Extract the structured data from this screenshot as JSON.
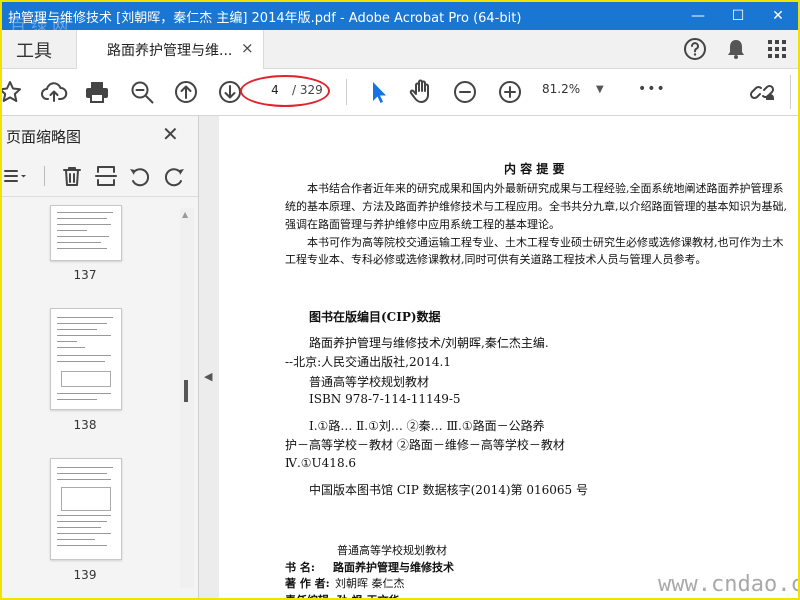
{
  "window": {
    "title": "护管理与维修技术 [刘朝晖，秦仁杰 主编] 2014年版.pdf - Adobe Acrobat Pro (64-bit)",
    "watermark": "百 绿 网",
    "controls": [
      "—",
      "☐",
      "✕"
    ]
  },
  "tabs": {
    "tools_label": "工具",
    "document_label": "路面养护管理与维...",
    "close_symbol": "×"
  },
  "toolbar": {
    "current_page": "4",
    "total_pages": "/ 329",
    "zoom": "81.2%",
    "more": "•••"
  },
  "sidebar": {
    "title": "页面缩略图",
    "close_symbol": "✕",
    "collapse_arrow": "◀",
    "thumbnails": [
      {
        "label": "137"
      },
      {
        "label": "138"
      },
      {
        "label": "139"
      }
    ]
  },
  "document": {
    "heading": "内  容  提  要",
    "para1_line1": "本书结合作者近年来的研究成果和国内外最新研究成果与工程经验,全面系统地阐述路面养护管理系",
    "para1_line2": "统的基本原理、方法及路面养护维修技术与工程应用。全书共分九章,以介绍路面管理的基本知识为基础,",
    "para1_line3": "强调在路面管理与养护维修中应用系统工程的基本理论。",
    "para2_line1": "本书可作为高等院校交通运输工程专业、土木工程专业硕士研究生必修或选修课教材,也可作为土木",
    "para2_line2": "工程专业本、专科必修或选修课教材,同时可供有关道路工程技术人员与管理人员参考。",
    "cip_title": "图书在版编目(CIP)数据",
    "cip_line1": "路面养护管理与维修技术/刘朝晖,秦仁杰主编.",
    "cip_line2": "--北京:人民交通出版社,2014.1",
    "cip_line3": "普通高等学校规划教材",
    "cip_line4": "ISBN 978-7-114-11149-5",
    "cip_line5": "Ⅰ.①路…  Ⅱ.①刘…  ②秦…  Ⅲ.①路面－公路养",
    "cip_line6": "护－高等学校－教材  ②路面－维修－高等学校－教材",
    "cip_line7": "Ⅳ.①U418.6",
    "cip_line8": "中国版本图书馆 CIP 数据核字(2014)第 016065 号",
    "series_label": "普通高等学校规划教材",
    "book_label": "书        名:",
    "book_value": "路面养护管理与维修技术",
    "author_label": "著  作  者:",
    "author_value": "刘朝晖    秦仁杰",
    "editor_partial": "责任编辑:  孙  飒    王文华"
  },
  "site_watermark": "www.cndao.com",
  "colors": {
    "titlebar": "#1976d2",
    "frame": "#f2e200",
    "page_ring": "#e0242b",
    "select_tool": "#1473e6"
  }
}
